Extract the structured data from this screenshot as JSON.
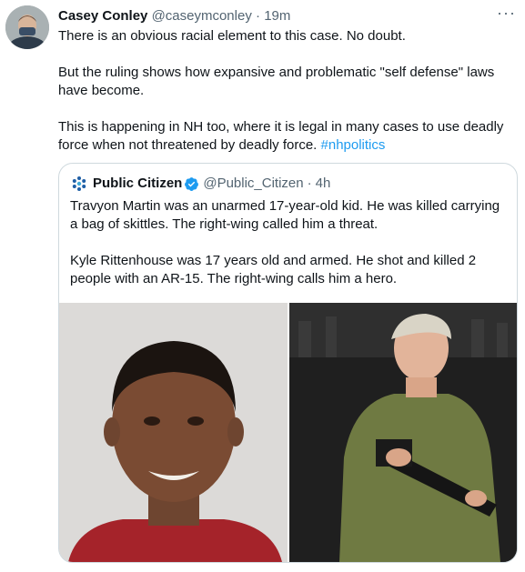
{
  "tweet": {
    "author_name": "Casey Conley",
    "author_handle": "@caseymconley",
    "separator": "·",
    "time": "19m",
    "paragraphs": [
      "There is an obvious racial element to this case. No doubt.",
      "But the ruling shows how expansive and problematic \"self defense\" laws have become."
    ],
    "last_paragraph_text": "This is happening in NH too, where it is legal in many cases to use deadly force when not threatened by deadly force. ",
    "hashtag": "#nhpolitics",
    "more_label": "···"
  },
  "quote": {
    "author_name": "Public Citizen",
    "author_handle": "@Public_Citizen",
    "separator": "·",
    "time": "4h",
    "paragraphs": [
      "Travyon Martin was an unarmed 17-year-old kid. He was killed carrying a bag of skittles. The right-wing called him a threat.",
      "Kyle Rittenhouse was 17 years old and armed. He shot and killed 2 people with an AR-15. The right-wing calls him a hero."
    ]
  },
  "colors": {
    "text": "#0f1419",
    "muted": "#536471",
    "link": "#1d9bf0",
    "border": "#cfd9de",
    "verified": "#1d9bf0",
    "logo": "#1f5fa6"
  },
  "icons": {
    "more": "more-horizontal-icon",
    "verified": "verified-badge-icon",
    "logo": "public-citizen-logo"
  }
}
